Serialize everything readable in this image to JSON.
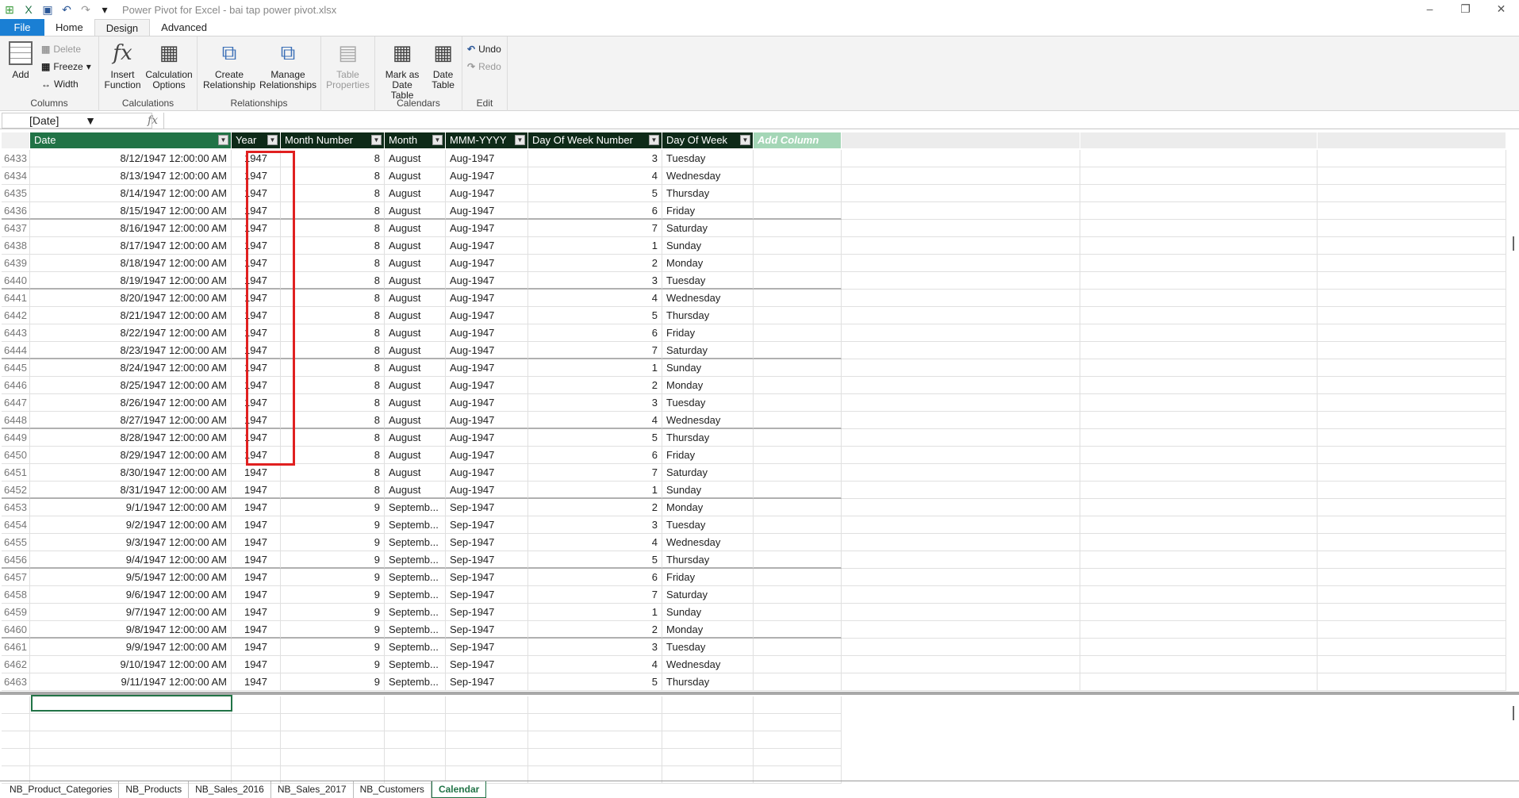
{
  "title": "Power Pivot for Excel - bai tap power pivot.xlsx",
  "tabs": [
    "File",
    "Home",
    "Design",
    "Advanced"
  ],
  "ribbon": {
    "columns": {
      "label": "Columns",
      "add": "Add",
      "delete": "Delete",
      "freeze": "Freeze",
      "width": "Width"
    },
    "calculations": {
      "label": "Calculations",
      "insert_function": [
        "Insert",
        "Function"
      ],
      "calc_options": [
        "Calculation",
        "Options"
      ]
    },
    "relationships": {
      "label": "Relationships",
      "create": [
        "Create",
        "Relationship"
      ],
      "manage": [
        "Manage",
        "Relationships"
      ]
    },
    "table_properties": [
      "Table",
      "Properties"
    ],
    "calendars": {
      "label": "Calendars",
      "mark": [
        "Mark as",
        "Date Table"
      ],
      "date_table": [
        "Date",
        "Table"
      ]
    },
    "edit": {
      "label": "Edit",
      "undo": "Undo",
      "redo": "Redo"
    }
  },
  "formula_bar": {
    "name_box": "[Date]",
    "fx": "fx",
    "formula": ""
  },
  "columns": [
    "Date",
    "Year",
    "Month Number",
    "Month",
    "MMM-YYYY",
    "Day Of Week Number",
    "Day Of Week",
    "Add Column"
  ],
  "rows": [
    [
      "6433",
      "8/12/1947 12:00:00 AM",
      "1947",
      "8",
      "August",
      "Aug-1947",
      "3",
      "Tuesday"
    ],
    [
      "6434",
      "8/13/1947 12:00:00 AM",
      "1947",
      "8",
      "August",
      "Aug-1947",
      "4",
      "Wednesday"
    ],
    [
      "6435",
      "8/14/1947 12:00:00 AM",
      "1947",
      "8",
      "August",
      "Aug-1947",
      "5",
      "Thursday"
    ],
    [
      "6436",
      "8/15/1947 12:00:00 AM",
      "1947",
      "8",
      "August",
      "Aug-1947",
      "6",
      "Friday"
    ],
    [
      "6437",
      "8/16/1947 12:00:00 AM",
      "1947",
      "8",
      "August",
      "Aug-1947",
      "7",
      "Saturday"
    ],
    [
      "6438",
      "8/17/1947 12:00:00 AM",
      "1947",
      "8",
      "August",
      "Aug-1947",
      "1",
      "Sunday"
    ],
    [
      "6439",
      "8/18/1947 12:00:00 AM",
      "1947",
      "8",
      "August",
      "Aug-1947",
      "2",
      "Monday"
    ],
    [
      "6440",
      "8/19/1947 12:00:00 AM",
      "1947",
      "8",
      "August",
      "Aug-1947",
      "3",
      "Tuesday"
    ],
    [
      "6441",
      "8/20/1947 12:00:00 AM",
      "1947",
      "8",
      "August",
      "Aug-1947",
      "4",
      "Wednesday"
    ],
    [
      "6442",
      "8/21/1947 12:00:00 AM",
      "1947",
      "8",
      "August",
      "Aug-1947",
      "5",
      "Thursday"
    ],
    [
      "6443",
      "8/22/1947 12:00:00 AM",
      "1947",
      "8",
      "August",
      "Aug-1947",
      "6",
      "Friday"
    ],
    [
      "6444",
      "8/23/1947 12:00:00 AM",
      "1947",
      "8",
      "August",
      "Aug-1947",
      "7",
      "Saturday"
    ],
    [
      "6445",
      "8/24/1947 12:00:00 AM",
      "1947",
      "8",
      "August",
      "Aug-1947",
      "1",
      "Sunday"
    ],
    [
      "6446",
      "8/25/1947 12:00:00 AM",
      "1947",
      "8",
      "August",
      "Aug-1947",
      "2",
      "Monday"
    ],
    [
      "6447",
      "8/26/1947 12:00:00 AM",
      "1947",
      "8",
      "August",
      "Aug-1947",
      "3",
      "Tuesday"
    ],
    [
      "6448",
      "8/27/1947 12:00:00 AM",
      "1947",
      "8",
      "August",
      "Aug-1947",
      "4",
      "Wednesday"
    ],
    [
      "6449",
      "8/28/1947 12:00:00 AM",
      "1947",
      "8",
      "August",
      "Aug-1947",
      "5",
      "Thursday"
    ],
    [
      "6450",
      "8/29/1947 12:00:00 AM",
      "1947",
      "8",
      "August",
      "Aug-1947",
      "6",
      "Friday"
    ],
    [
      "6451",
      "8/30/1947 12:00:00 AM",
      "1947",
      "8",
      "August",
      "Aug-1947",
      "7",
      "Saturday"
    ],
    [
      "6452",
      "8/31/1947 12:00:00 AM",
      "1947",
      "8",
      "August",
      "Aug-1947",
      "1",
      "Sunday"
    ],
    [
      "6453",
      "9/1/1947 12:00:00 AM",
      "1947",
      "9",
      "Septemb...",
      "Sep-1947",
      "2",
      "Monday"
    ],
    [
      "6454",
      "9/2/1947 12:00:00 AM",
      "1947",
      "9",
      "Septemb...",
      "Sep-1947",
      "3",
      "Tuesday"
    ],
    [
      "6455",
      "9/3/1947 12:00:00 AM",
      "1947",
      "9",
      "Septemb...",
      "Sep-1947",
      "4",
      "Wednesday"
    ],
    [
      "6456",
      "9/4/1947 12:00:00 AM",
      "1947",
      "9",
      "Septemb...",
      "Sep-1947",
      "5",
      "Thursday"
    ],
    [
      "6457",
      "9/5/1947 12:00:00 AM",
      "1947",
      "9",
      "Septemb...",
      "Sep-1947",
      "6",
      "Friday"
    ],
    [
      "6458",
      "9/6/1947 12:00:00 AM",
      "1947",
      "9",
      "Septemb...",
      "Sep-1947",
      "7",
      "Saturday"
    ],
    [
      "6459",
      "9/7/1947 12:00:00 AM",
      "1947",
      "9",
      "Septemb...",
      "Sep-1947",
      "1",
      "Sunday"
    ],
    [
      "6460",
      "9/8/1947 12:00:00 AM",
      "1947",
      "9",
      "Septemb...",
      "Sep-1947",
      "2",
      "Monday"
    ],
    [
      "6461",
      "9/9/1947 12:00:00 AM",
      "1947",
      "9",
      "Septemb...",
      "Sep-1947",
      "3",
      "Tuesday"
    ],
    [
      "6462",
      "9/10/1947 12:00:00 AM",
      "1947",
      "9",
      "Septemb...",
      "Sep-1947",
      "4",
      "Wednesday"
    ],
    [
      "6463",
      "9/11/1947 12:00:00 AM",
      "1947",
      "9",
      "Septemb...",
      "Sep-1947",
      "5",
      "Thursday"
    ]
  ],
  "sheets": [
    "NB_Product_Categories",
    "NB_Products",
    "NB_Sales_2016",
    "NB_Sales_2017",
    "NB_Customers",
    "Calendar"
  ],
  "active_sheet": "Calendar",
  "colors": {
    "accent": "#217346",
    "highlight": "#e02020"
  }
}
